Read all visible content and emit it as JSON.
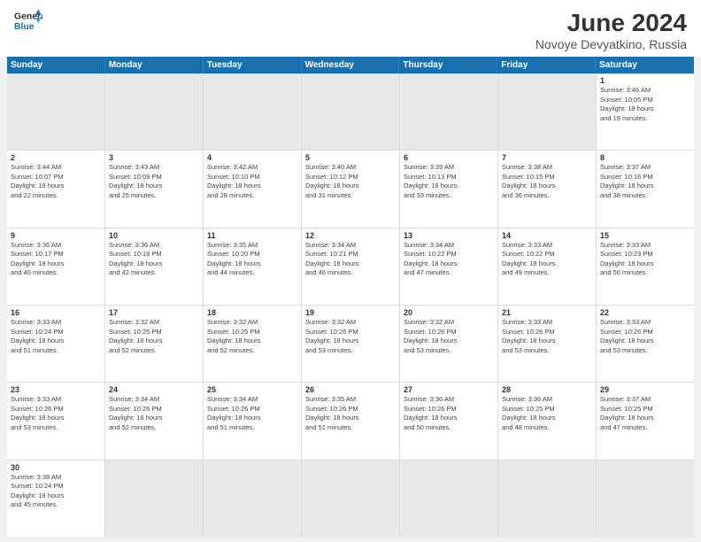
{
  "header": {
    "logo_line1": "General",
    "logo_line2": "Blue",
    "main_title": "June 2024",
    "sub_title": "Novoye Devyatkino, Russia"
  },
  "weekdays": [
    "Sunday",
    "Monday",
    "Tuesday",
    "Wednesday",
    "Thursday",
    "Friday",
    "Saturday"
  ],
  "weeks": [
    [
      {
        "day": "",
        "info": ""
      },
      {
        "day": "",
        "info": ""
      },
      {
        "day": "",
        "info": ""
      },
      {
        "day": "",
        "info": ""
      },
      {
        "day": "",
        "info": ""
      },
      {
        "day": "",
        "info": ""
      },
      {
        "day": "1",
        "info": "Sunrise: 3:46 AM\nSunset: 10:05 PM\nDaylight: 18 hours\nand 19 minutes."
      }
    ],
    [
      {
        "day": "2",
        "info": "Sunrise: 3:44 AM\nSunset: 10:07 PM\nDaylight: 18 hours\nand 22 minutes."
      },
      {
        "day": "3",
        "info": "Sunrise: 3:43 AM\nSunset: 10:09 PM\nDaylight: 18 hours\nand 25 minutes."
      },
      {
        "day": "4",
        "info": "Sunrise: 3:42 AM\nSunset: 10:10 PM\nDaylight: 18 hours\nand 28 minutes."
      },
      {
        "day": "5",
        "info": "Sunrise: 3:40 AM\nSunset: 10:12 PM\nDaylight: 18 hours\nand 31 minutes."
      },
      {
        "day": "6",
        "info": "Sunrise: 3:39 AM\nSunset: 10:13 PM\nDaylight: 18 hours\nand 33 minutes."
      },
      {
        "day": "7",
        "info": "Sunrise: 3:38 AM\nSunset: 10:15 PM\nDaylight: 18 hours\nand 36 minutes."
      },
      {
        "day": "8",
        "info": "Sunrise: 3:37 AM\nSunset: 10:16 PM\nDaylight: 18 hours\nand 38 minutes."
      }
    ],
    [
      {
        "day": "9",
        "info": "Sunrise: 3:36 AM\nSunset: 10:17 PM\nDaylight: 18 hours\nand 40 minutes."
      },
      {
        "day": "10",
        "info": "Sunrise: 3:36 AM\nSunset: 10:18 PM\nDaylight: 18 hours\nand 42 minutes."
      },
      {
        "day": "11",
        "info": "Sunrise: 3:35 AM\nSunset: 10:20 PM\nDaylight: 18 hours\nand 44 minutes."
      },
      {
        "day": "12",
        "info": "Sunrise: 3:34 AM\nSunset: 10:21 PM\nDaylight: 18 hours\nand 46 minutes."
      },
      {
        "day": "13",
        "info": "Sunrise: 3:34 AM\nSunset: 10:22 PM\nDaylight: 18 hours\nand 47 minutes."
      },
      {
        "day": "14",
        "info": "Sunrise: 3:33 AM\nSunset: 10:22 PM\nDaylight: 18 hours\nand 49 minutes."
      },
      {
        "day": "15",
        "info": "Sunrise: 3:33 AM\nSunset: 10:23 PM\nDaylight: 18 hours\nand 50 minutes."
      }
    ],
    [
      {
        "day": "16",
        "info": "Sunrise: 3:33 AM\nSunset: 10:24 PM\nDaylight: 18 hours\nand 51 minutes."
      },
      {
        "day": "17",
        "info": "Sunrise: 3:32 AM\nSunset: 10:25 PM\nDaylight: 18 hours\nand 52 minutes."
      },
      {
        "day": "18",
        "info": "Sunrise: 3:32 AM\nSunset: 10:25 PM\nDaylight: 18 hours\nand 52 minutes."
      },
      {
        "day": "19",
        "info": "Sunrise: 3:32 AM\nSunset: 10:26 PM\nDaylight: 18 hours\nand 53 minutes."
      },
      {
        "day": "20",
        "info": "Sunrise: 3:32 AM\nSunset: 10:26 PM\nDaylight: 18 hours\nand 53 minutes."
      },
      {
        "day": "21",
        "info": "Sunrise: 3:33 AM\nSunset: 10:26 PM\nDaylight: 18 hours\nand 53 minutes."
      },
      {
        "day": "22",
        "info": "Sunrise: 3:33 AM\nSunset: 10:26 PM\nDaylight: 18 hours\nand 53 minutes."
      }
    ],
    [
      {
        "day": "23",
        "info": "Sunrise: 3:33 AM\nSunset: 10:26 PM\nDaylight: 18 hours\nand 53 minutes."
      },
      {
        "day": "24",
        "info": "Sunrise: 3:34 AM\nSunset: 10:26 PM\nDaylight: 18 hours\nand 52 minutes."
      },
      {
        "day": "25",
        "info": "Sunrise: 3:34 AM\nSunset: 10:26 PM\nDaylight: 18 hours\nand 51 minutes."
      },
      {
        "day": "26",
        "info": "Sunrise: 3:35 AM\nSunset: 10:26 PM\nDaylight: 18 hours\nand 51 minutes."
      },
      {
        "day": "27",
        "info": "Sunrise: 3:36 AM\nSunset: 10:26 PM\nDaylight: 18 hours\nand 50 minutes."
      },
      {
        "day": "28",
        "info": "Sunrise: 3:36 AM\nSunset: 10:25 PM\nDaylight: 18 hours\nand 48 minutes."
      },
      {
        "day": "29",
        "info": "Sunrise: 3:37 AM\nSunset: 10:25 PM\nDaylight: 18 hours\nand 47 minutes."
      }
    ],
    [
      {
        "day": "30",
        "info": "Sunrise: 3:38 AM\nSunset: 10:24 PM\nDaylight: 18 hours\nand 45 minutes."
      },
      {
        "day": "",
        "info": ""
      },
      {
        "day": "",
        "info": ""
      },
      {
        "day": "",
        "info": ""
      },
      {
        "day": "",
        "info": ""
      },
      {
        "day": "",
        "info": ""
      },
      {
        "day": "",
        "info": ""
      }
    ]
  ]
}
